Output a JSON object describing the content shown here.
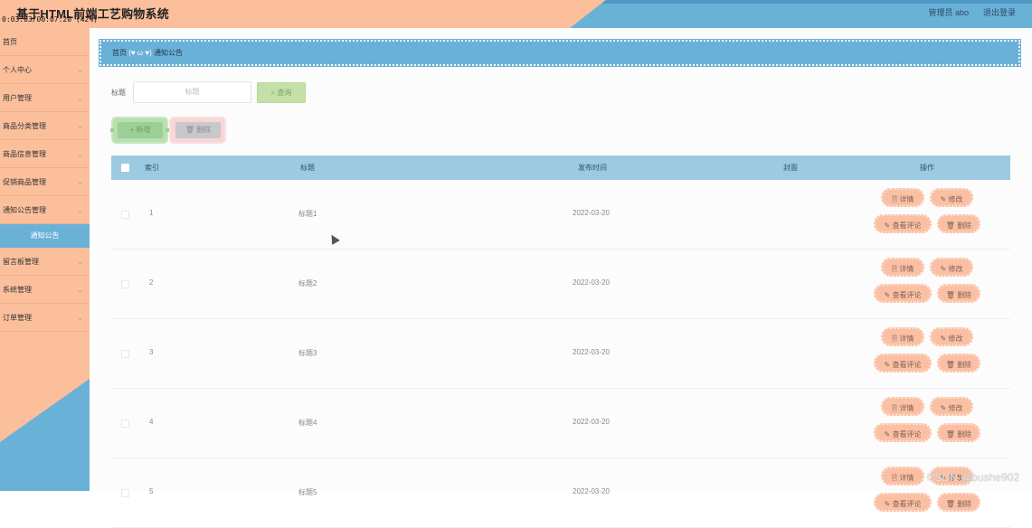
{
  "header": {
    "title": "基于HTML前端工艺购物系统",
    "subtitle": "0:03:03/00:07:20 (42%)",
    "user_label": "管理员 abo",
    "logout_label": "退出登录"
  },
  "sidebar": {
    "items": [
      {
        "label": "首页",
        "has_chevron": false
      },
      {
        "label": "个人中心",
        "has_chevron": true
      },
      {
        "label": "用户管理",
        "has_chevron": true
      },
      {
        "label": "商品分类管理",
        "has_chevron": true
      },
      {
        "label": "商品信息管理",
        "has_chevron": true
      },
      {
        "label": "促销商品管理",
        "has_chevron": true
      },
      {
        "label": "通知公告管理",
        "has_chevron": true
      },
      {
        "label": "通知公告",
        "sub": true
      },
      {
        "label": "留言板管理",
        "has_chevron": true
      },
      {
        "label": "系统管理",
        "has_chevron": true
      },
      {
        "label": "订单管理",
        "has_chevron": true
      }
    ]
  },
  "breadcrumb": {
    "home": "首页",
    "separator": "(♥ ω ♥)",
    "current": "通知公告"
  },
  "search": {
    "label": "标题",
    "placeholder": "标题",
    "button": "查询"
  },
  "actions": {
    "add": "新增",
    "delete": "删除"
  },
  "table": {
    "headers": {
      "index": "索引",
      "title": "标题",
      "time": "发布时间",
      "cover": "封面",
      "operation": "操作"
    },
    "row_ops": {
      "detail": "详情",
      "edit": "修改",
      "comment": "查看评论",
      "delete": "删除"
    },
    "rows": [
      {
        "index": "1",
        "title": "标题1",
        "time": "2022-03-20"
      },
      {
        "index": "2",
        "title": "标题2",
        "time": "2022-03-20"
      },
      {
        "index": "3",
        "title": "标题3",
        "time": "2022-03-20"
      },
      {
        "index": "4",
        "title": "标题4",
        "time": "2022-03-20"
      },
      {
        "index": "5",
        "title": "标题5",
        "time": "2022-03-20"
      }
    ]
  },
  "watermark": "CSDN @bushe902",
  "colors": {
    "peach": "#fbbf9c",
    "blue": "#6ab1d8",
    "table_header": "#9ccae1"
  }
}
